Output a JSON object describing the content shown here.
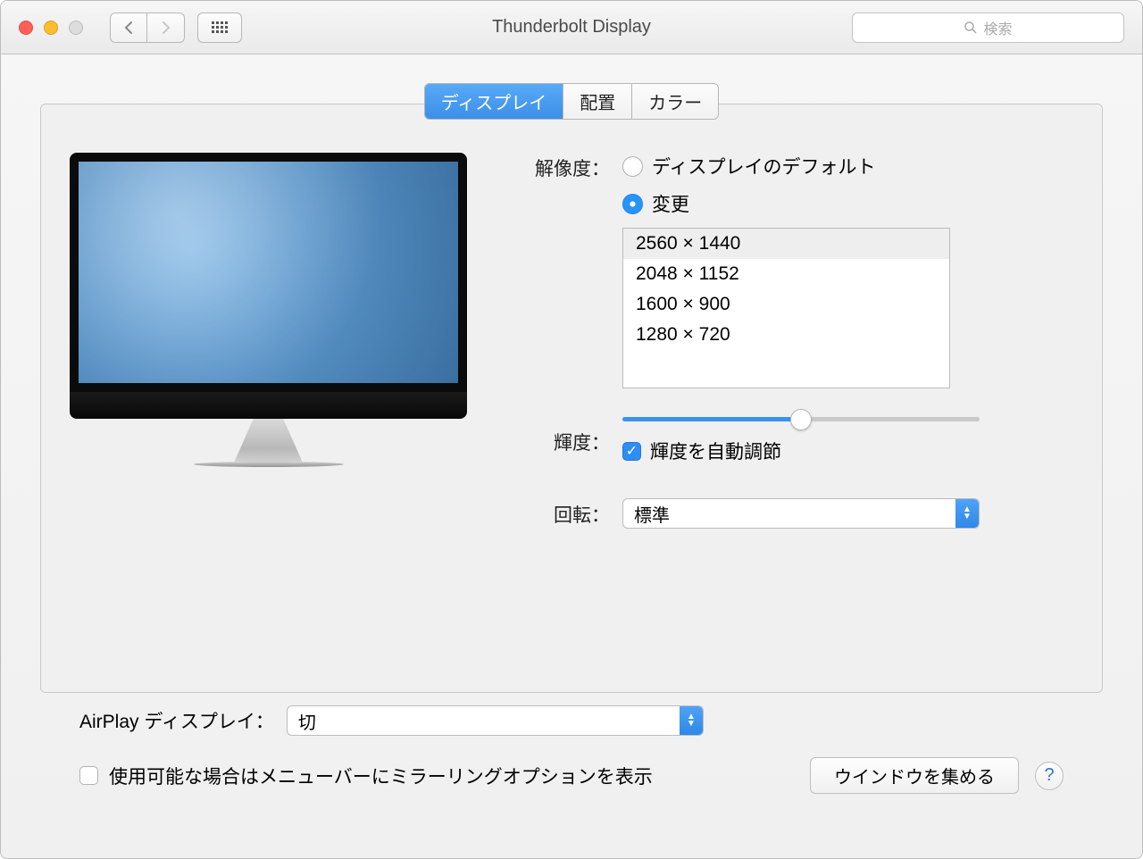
{
  "window": {
    "title": "Thunderbolt Display"
  },
  "search": {
    "placeholder": "検索"
  },
  "tabs": {
    "display": "ディスプレイ",
    "arrangement": "配置",
    "color": "カラー"
  },
  "labels": {
    "resolution": "解像度：",
    "brightness": "輝度：",
    "rotation": "回転："
  },
  "resolution": {
    "default_label": "ディスプレイのデフォルト",
    "scaled_label": "変更",
    "options": [
      "2560 × 1440",
      "2048 × 1152",
      "1600 × 900",
      "1280 × 720"
    ],
    "selected_index": 0
  },
  "brightness": {
    "value_percent": 50,
    "auto_label": "輝度を自動調節",
    "auto_checked": true
  },
  "rotation": {
    "value": "標準"
  },
  "airplay": {
    "label": "AirPlay ディスプレイ：",
    "value": "切"
  },
  "mirror_opt": {
    "label": "使用可能な場合はメニューバーにミラーリングオプションを表示",
    "checked": false
  },
  "gather_button": "ウインドウを集める",
  "help": "?"
}
